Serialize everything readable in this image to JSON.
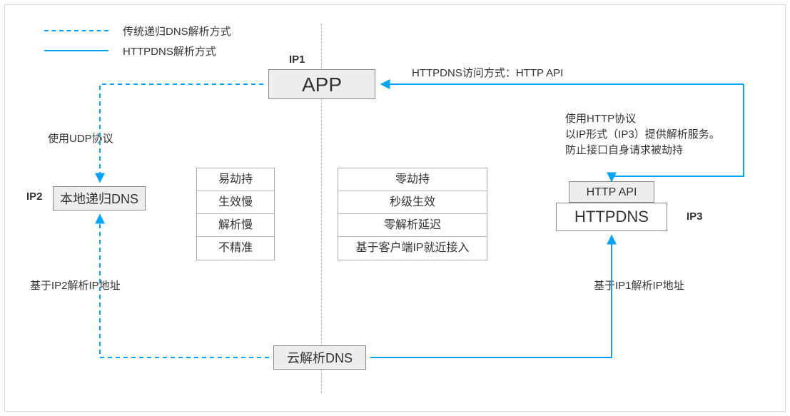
{
  "legend": {
    "dashed_label": "传统递归DNS解析方式",
    "solid_label": "HTTPDNS解析方式"
  },
  "nodes": {
    "ip1_tag": "IP1",
    "app_label": "APP",
    "ip2_tag": "IP2",
    "local_dns_label": "本地递归DNS",
    "cloud_dns_label": "云解析DNS",
    "http_api_label": "HTTP API",
    "httpdns_label": "HTTPDNS",
    "ip3_tag": "IP3"
  },
  "lists": {
    "traditional": {
      "items": [
        "易劫持",
        "生效慢",
        "解析慢",
        "不精准"
      ]
    },
    "httpdns": {
      "items": [
        "零劫持",
        "秒级生效",
        "零解析延迟",
        "基于客户端IP就近接入"
      ]
    }
  },
  "annotations": {
    "top_right": "HTTPDNS访问方式：HTTP API",
    "right_side_line1": "使用HTTP协议",
    "right_side_line2": "以IP形式（IP3）提供解析服务。",
    "right_side_line3": "防止接口自身请求被劫持",
    "bottom_right": "基于IP1解析IP地址",
    "left_udp": "使用UDP协议",
    "bottom_left": "基于IP2解析IP地址"
  },
  "colors": {
    "line_solid": "#00a4ff",
    "line_dashed": "#00a4ff",
    "divider": "#bbbbbb",
    "node_bg": "#ededed"
  }
}
